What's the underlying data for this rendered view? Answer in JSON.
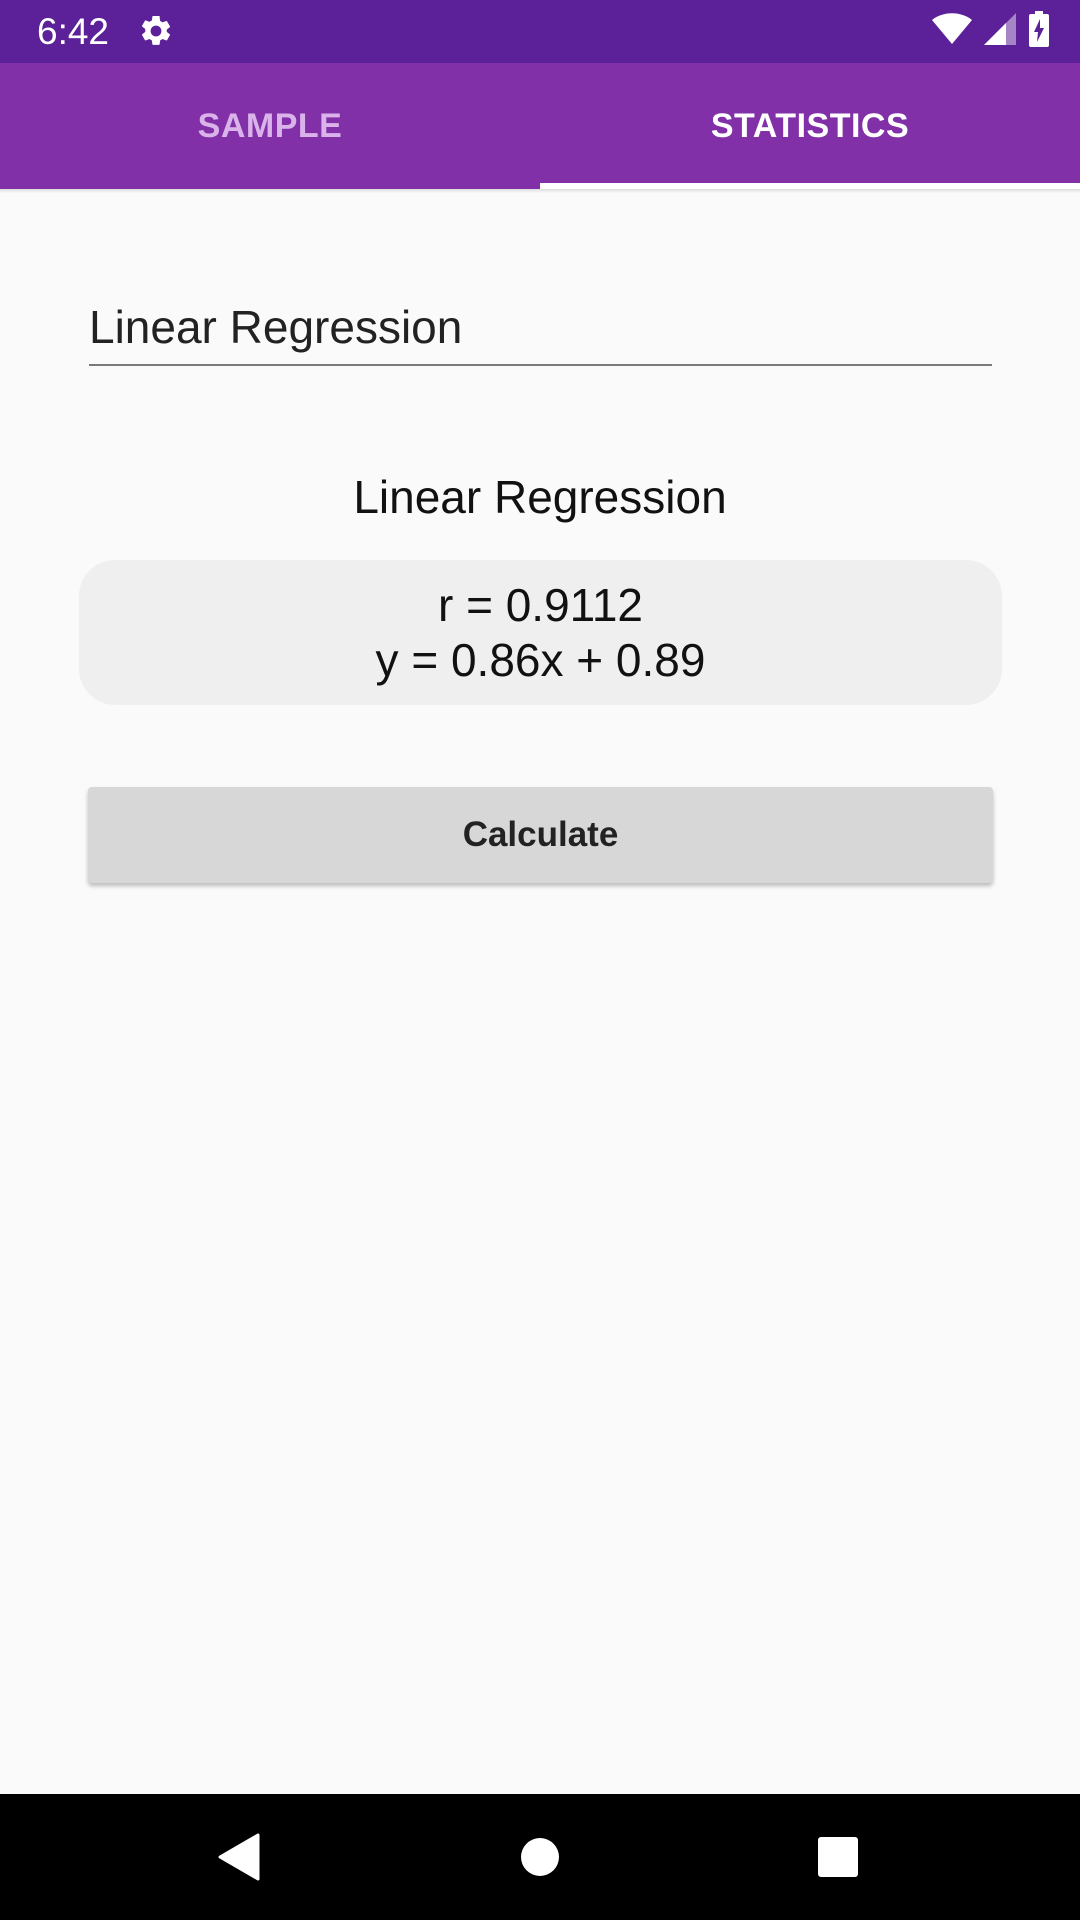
{
  "status_bar": {
    "time": "6:42",
    "icons": [
      "gear-icon",
      "wifi-icon",
      "signal-icon",
      "battery-icon"
    ]
  },
  "tabs": [
    {
      "label": "SAMPLE",
      "active": false
    },
    {
      "label": "STATISTICS",
      "active": true
    }
  ],
  "form": {
    "name_value": "Linear Regression"
  },
  "result": {
    "title": "Linear Regression",
    "line1": "r = 0.9112",
    "line2": "y = 0.86x + 0.89"
  },
  "actions": {
    "calculate_label": "Calculate"
  },
  "nav": {
    "icons": [
      "back-icon",
      "home-icon",
      "recents-icon"
    ]
  },
  "colors": {
    "status_bar": "#5c2198",
    "tab_bar": "#8130a8",
    "tab_inactive_text": "#dab3ea",
    "tab_active_text": "#ffffff",
    "background": "#fafafa",
    "result_box": "#efefef",
    "button": "#d7d7d7"
  }
}
